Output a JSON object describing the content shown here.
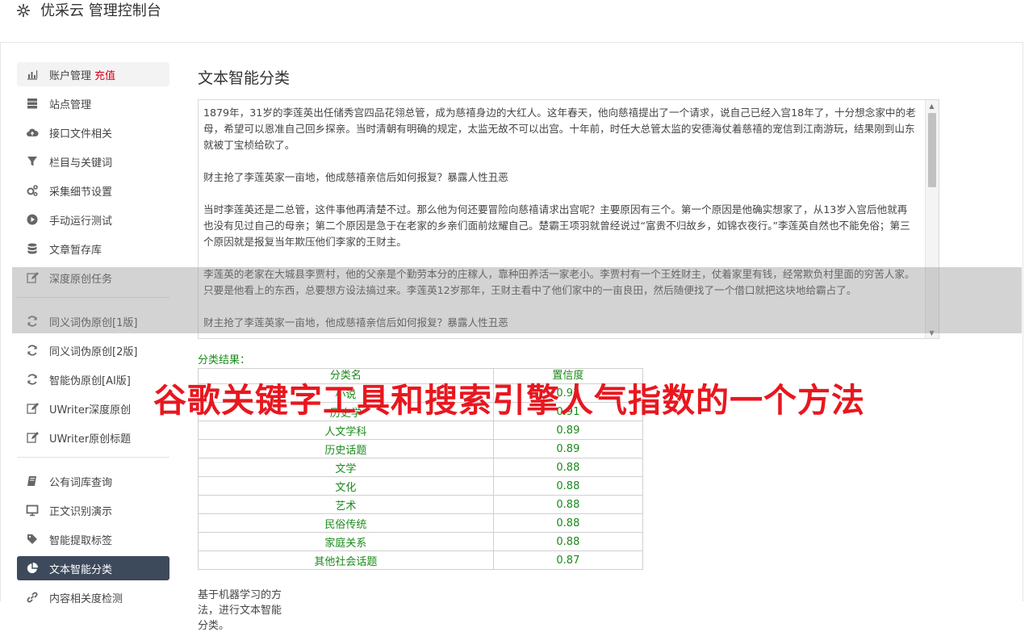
{
  "app": {
    "title": "优采云 管理控制台",
    "icon": "gear-icon"
  },
  "sidebar": {
    "group1": [
      {
        "label": "账户管理",
        "extra": "充值",
        "icon": "bar-chart-icon"
      },
      {
        "label": "站点管理",
        "icon": "server-icon"
      },
      {
        "label": "接口文件相关",
        "icon": "cloud-upload-icon"
      },
      {
        "label": "栏目与关键词",
        "icon": "filter-icon"
      },
      {
        "label": "采集细节设置",
        "icon": "gears-icon"
      },
      {
        "label": "手动运行测试",
        "icon": "play-circle-icon"
      },
      {
        "label": "文章暂存库",
        "icon": "database-icon"
      },
      {
        "label": "深度原创任务",
        "icon": "edit-icon"
      }
    ],
    "group2": [
      {
        "label": "同义词伪原创[1版]",
        "icon": "refresh-icon"
      },
      {
        "label": "同义词伪原创[2版]",
        "icon": "refresh-icon"
      },
      {
        "label": "智能伪原创[AI版]",
        "icon": "refresh-icon"
      },
      {
        "label": "UWriter深度原创",
        "icon": "edit-icon"
      },
      {
        "label": "UWriter原创标题",
        "icon": "edit-icon"
      }
    ],
    "group3": [
      {
        "label": "公有词库查询",
        "icon": "book-icon"
      },
      {
        "label": "正文识别演示",
        "icon": "monitor-icon"
      },
      {
        "label": "智能提取标签",
        "icon": "tag-icon"
      },
      {
        "label": "文本智能分类",
        "icon": "pie-chart-icon"
      },
      {
        "label": "内容相关度检测",
        "icon": "link-icon"
      }
    ]
  },
  "main": {
    "title": "文本智能分类",
    "paragraphs": [
      "1879年，31岁的李莲英出任储秀宫四品花翎总管，成为慈禧身边的大红人。这年春天，他向慈禧提出了一个请求，说自己已经入宫18年了，十分想念家中的老母，希望可以恩准自己回乡探亲。当时清朝有明确的规定，太监无故不可以出宫。十年前，时任大总管太监的安德海仗着慈禧的宠信到江南游玩，结果刚到山东就被丁宝桢给砍了。",
      "财主抢了李莲英家一亩地，他成慈禧亲信后如何报复？暴露人性丑恶",
      "当时李莲英还是二总管，这件事他再清楚不过。那么他为何还要冒险向慈禧请求出宫呢？主要原因有三个。第一个原因是他确实想家了，从13岁入宫后他就再也没有见过自己的母亲；第二个原因是急于在老家的乡亲们面前炫耀自己。楚霸王项羽就曾经说过“富贵不归故乡，如锦衣夜行。”李莲英自然也不能免俗；第三个原因就是报复当年欺压他们李家的王财主。",
      "李莲英的老家在大城县李贾村，他的父亲是个勤劳本分的庄稼人，靠种田养活一家老小。李贾村有一个王姓财主，仗着家里有钱，经常欺负村里面的穷苦人家。只要是他看上的东西，总要想方设法搞过来。李莲英12岁那年，王财主看中了他们家中的一亩良田，然后随便找了一个借口就把这块地给霸占了。",
      "财主抢了李莲英家一亩地，他成慈禧亲信后如何报复？暴露人性丑恶"
    ],
    "result_label": "分类结果：",
    "table": {
      "headers": [
        "分类名",
        "置信度"
      ],
      "rows": [
        [
          "小说",
          "0.92"
        ],
        [
          "历史学",
          "0.91"
        ],
        [
          "人文学科",
          "0.89"
        ],
        [
          "历史话题",
          "0.89"
        ],
        [
          "文学",
          "0.88"
        ],
        [
          "文化",
          "0.88"
        ],
        [
          "艺术",
          "0.88"
        ],
        [
          "民俗传统",
          "0.88"
        ],
        [
          "家庭关系",
          "0.88"
        ],
        [
          "其他社会话题",
          "0.87"
        ]
      ]
    },
    "footnote": "基于机器学习的方法，进行文本智能分类。"
  },
  "watermark": "谷歌关键字工具和搜索引擎人气指数的一个方法",
  "colors": {
    "active_bg": "#3d4a5c",
    "result_green": "#1a8a1a",
    "accent_red": "#d9001b",
    "watermark": "#e8171f"
  }
}
